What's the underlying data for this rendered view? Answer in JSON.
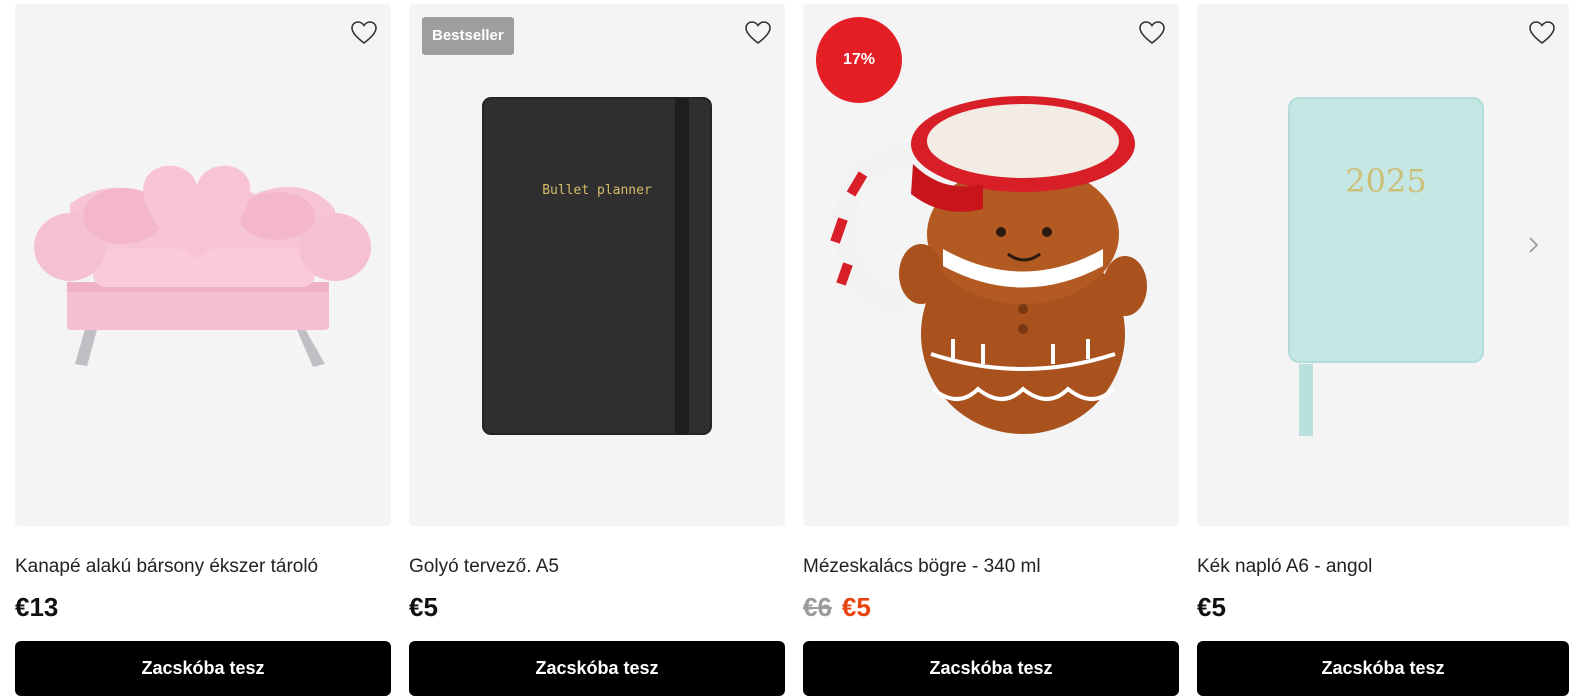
{
  "products": [
    {
      "title": "Kanapé alakú bársony ékszer tároló",
      "price": "€13",
      "button": "Zacskóba tesz"
    },
    {
      "badge": "Bestseller",
      "title": "Golyó tervező. A5",
      "price": "€5",
      "button": "Zacskóba tesz",
      "product_text": "Bullet planner"
    },
    {
      "badge": "17%",
      "title": "Mézeskalács bögre - 340 ml",
      "old_price": "€6",
      "price": "€5",
      "button": "Zacskóba tesz"
    },
    {
      "title": "Kék napló A6 - angol",
      "price": "€5",
      "button": "Zacskóba tesz",
      "product_text": "2025"
    }
  ],
  "colors": {
    "discount_badge": "#e31e24",
    "sale_price": "#e8420f",
    "button_bg": "#000000",
    "bestseller_badge": "#9e9e9e"
  },
  "icons": {
    "wishlist": "heart-outline-icon",
    "carousel_next": "chevron-right-icon"
  }
}
